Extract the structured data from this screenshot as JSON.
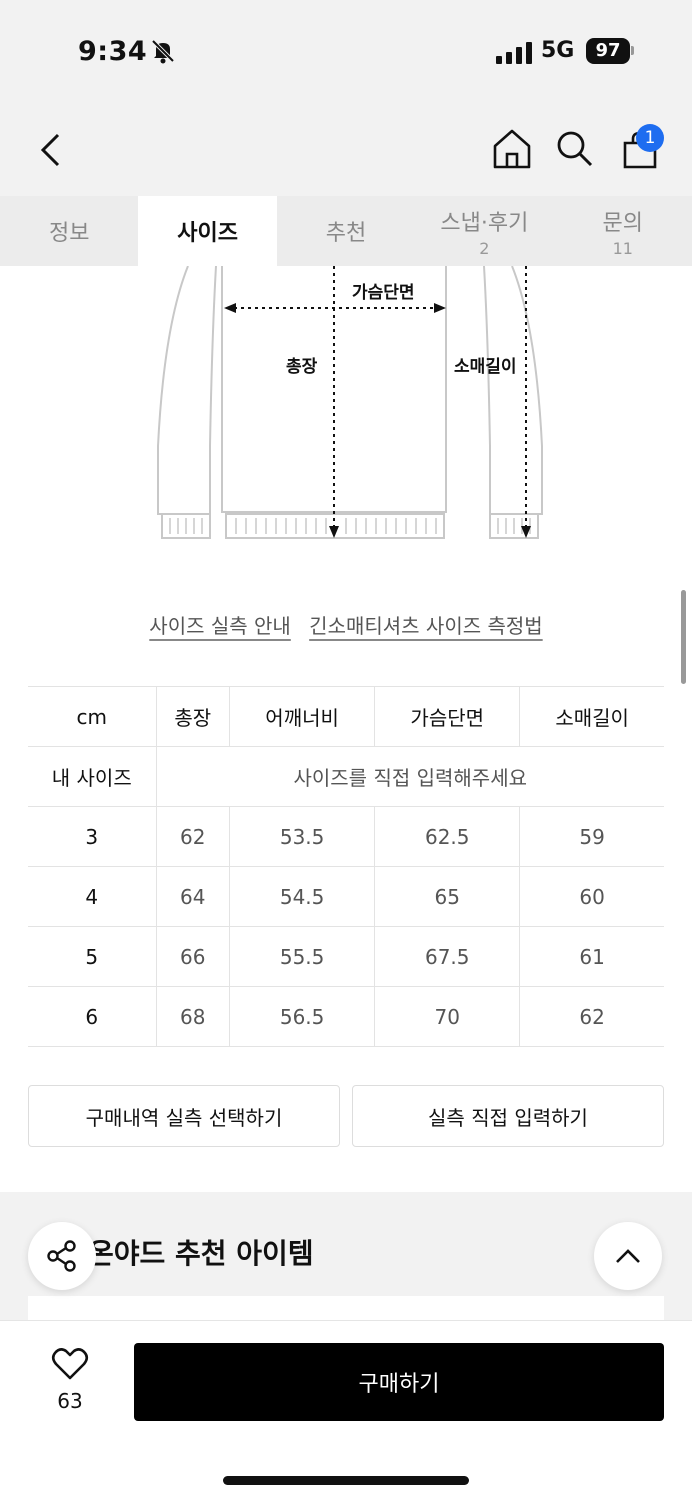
{
  "status": {
    "time": "9:34",
    "network": "5G",
    "battery": "97"
  },
  "nav": {
    "cart_count": "1"
  },
  "tabs": [
    {
      "label": "정보",
      "count": ""
    },
    {
      "label": "사이즈",
      "count": ""
    },
    {
      "label": "추천",
      "count": ""
    },
    {
      "label": "스냅·후기",
      "count": "2"
    },
    {
      "label": "문의",
      "count": "11"
    }
  ],
  "diagram": {
    "chest": "가슴단면",
    "length": "총장",
    "sleeve": "소매길이"
  },
  "links": {
    "guide": "사이즈 실측 안내",
    "method": "긴소매티셔츠 사이즈 측정법"
  },
  "table": {
    "headers": [
      "cm",
      "총장",
      "어깨너비",
      "가슴단면",
      "소매길이"
    ],
    "my_size_label": "내 사이즈",
    "my_size_prompt": "사이즈를 직접 입력해주세요",
    "rows": [
      [
        "3",
        "62",
        "53.5",
        "62.5",
        "59"
      ],
      [
        "4",
        "64",
        "54.5",
        "65",
        "60"
      ],
      [
        "5",
        "66",
        "55.5",
        "67.5",
        "61"
      ],
      [
        "6",
        "68",
        "56.5",
        "70",
        "62"
      ]
    ]
  },
  "buttons": {
    "history": "구매내역 실측 선택하기",
    "direct": "실측 직접 입력하기"
  },
  "recommend": {
    "title": "온야드 추천 아이템"
  },
  "bottom": {
    "like_count": "63",
    "buy": "구매하기"
  }
}
